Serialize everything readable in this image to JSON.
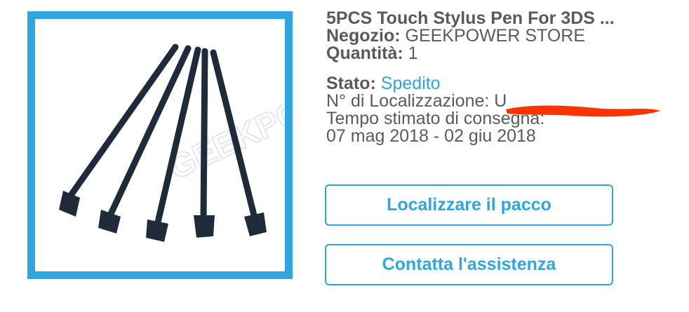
{
  "product": {
    "image_icon": "stylus-pens-photo",
    "watermark": "GEEKPOWER",
    "title": "5PCS Touch Stylus Pen For 3DS ...",
    "store_label": "Negozio:",
    "store_value": "GEEKPOWER STORE",
    "quantity_label": "Quantità:",
    "quantity_value": "1"
  },
  "shipping": {
    "status_label": "Stato:",
    "status_value": "Spedito",
    "tracking_label": "N° di Localizzazione:",
    "tracking_value_visible": "U",
    "eta_label": "Tempo stimato di consegna:",
    "eta_value": "07 mag 2018 - 02 giu 2018"
  },
  "actions": {
    "track_label": "Localizzare il pacco",
    "support_label": "Contatta l'assistenza"
  },
  "colors": {
    "accent": "#2ea6e0",
    "text": "#5a5a5a",
    "redaction": "#ff3300"
  }
}
